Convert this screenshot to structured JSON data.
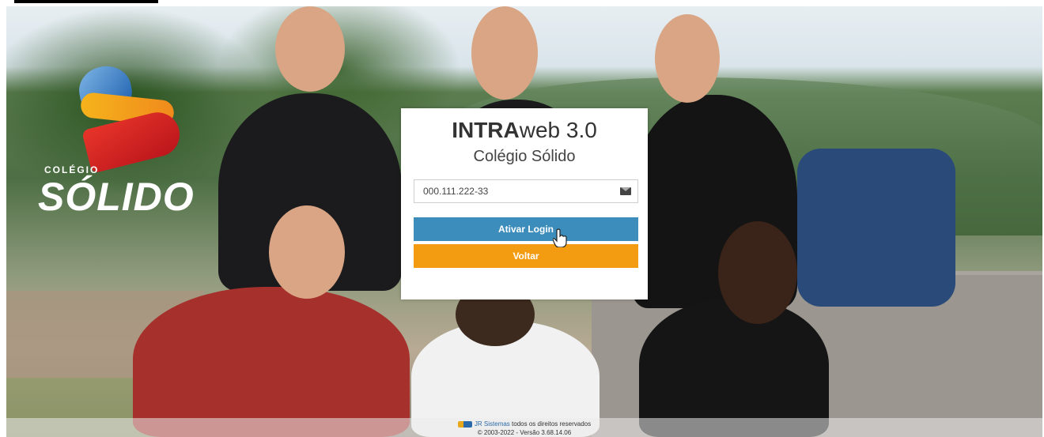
{
  "login": {
    "title_bold": "INTRA",
    "title_rest": "web 3.0",
    "subtitle": "Colégio Sólido",
    "username_value": "000.111.222-33",
    "login_button": "Ativar Login",
    "back_button": "Voltar"
  },
  "logo": {
    "small_text": "COLÉGIO",
    "big_text": "SÓLIDO"
  },
  "footer": {
    "company": "JR Sistemas",
    "rights": " todos os direitos reservados",
    "version": "© 2003-2022 - Versão 3.68.14.06"
  },
  "colors": {
    "primary_button": "#3c8dbc",
    "secondary_button": "#f39c12"
  }
}
